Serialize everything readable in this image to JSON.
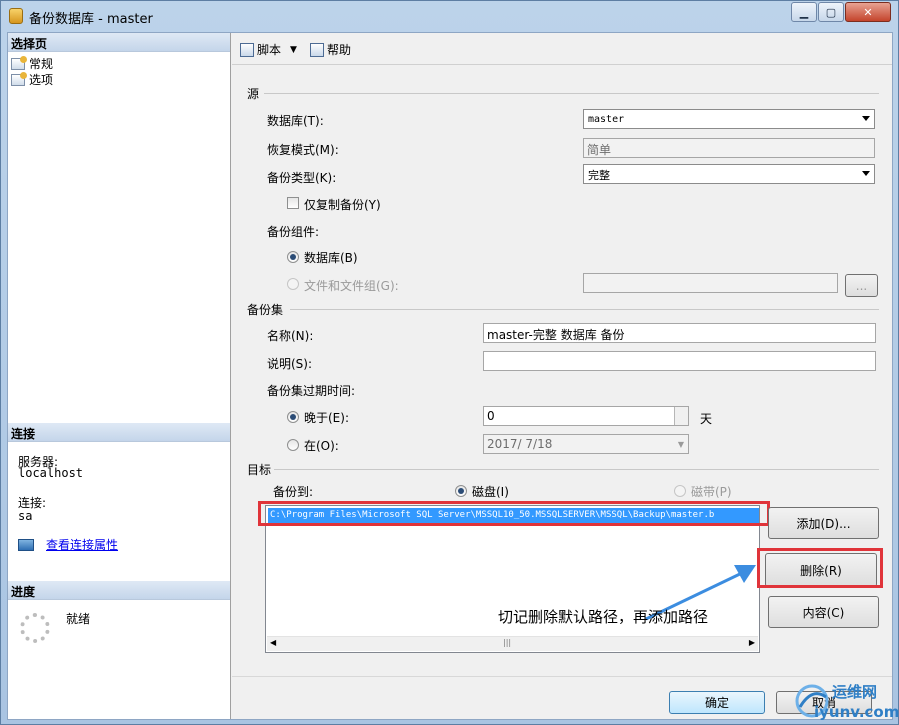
{
  "window": {
    "title": "备份数据库 - master"
  },
  "left": {
    "select_header": "选择页",
    "pages": [
      "常规",
      "选项"
    ],
    "connection_header": "连接",
    "server_label": "服务器:",
    "server_value": "localhost",
    "connection_label": "连接:",
    "connection_value": "sa",
    "view_link": "查看连接属性",
    "progress_header": "进度",
    "progress_status": "就绪"
  },
  "toolbar": {
    "script": "脚本",
    "help": "帮助"
  },
  "source": {
    "section": "源",
    "database_label": "数据库(T):",
    "database_value": "master",
    "recovery_label": "恢复模式(M):",
    "recovery_value": "简单",
    "backup_type_label": "备份类型(K):",
    "backup_type_value": "完整",
    "copy_only_label": "仅复制备份(Y)",
    "component_label": "备份组件:",
    "component_db": "数据库(B)",
    "component_files": "文件和文件组(G):",
    "ellipsis": "..."
  },
  "backupset": {
    "section": "备份集",
    "name_label": "名称(N):",
    "name_value": "master-完整 数据库 备份",
    "desc_label": "说明(S):",
    "desc_value": "",
    "expire_label": "备份集过期时间:",
    "after_label": "晚于(E):",
    "after_value": "0",
    "days": "天",
    "on_label": "在(O):",
    "on_value": "2017/ 7/18"
  },
  "destination": {
    "section": "目标",
    "backup_to": "备份到:",
    "disk": "磁盘(I)",
    "tape": "磁带(P)",
    "path": "C:\\Program Files\\Microsoft SQL Server\\MSSQL10_50.MSSQLSERVER\\MSSQL\\Backup\\master.b",
    "add": "添加(D)...",
    "delete": "删除(R)",
    "contents": "内容(C)",
    "annotation": "切记删除默认路径，再添加路径"
  },
  "footer": {
    "ok": "确定",
    "cancel": "取消"
  },
  "watermark": {
    "brand": "运维网",
    "site": "iyunv.com"
  },
  "colors": {
    "highlight": "#3399ff",
    "annotation_red": "#e0343a",
    "arrow_blue": "#3c8de0"
  }
}
